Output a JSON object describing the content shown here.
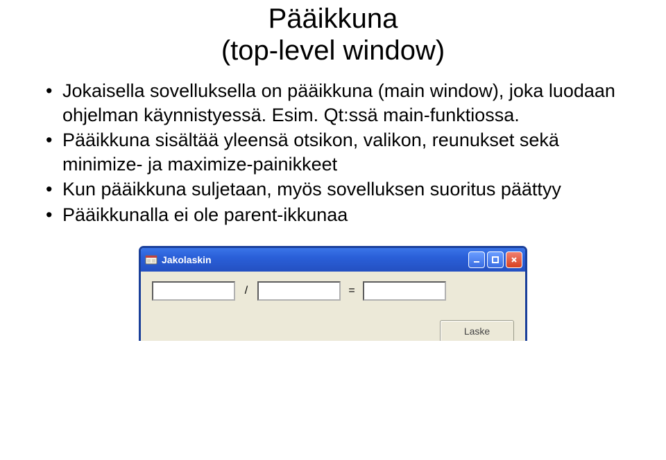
{
  "title_line1": "Pääikkuna",
  "title_line2": "(top-level window)",
  "bullets": [
    "Jokaisella sovelluksella on pääikkuna (main window), joka luodaan ohjelman käynnistyessä. Esim. Qt:ssä main-funktiossa.",
    "Pääikkuna sisältää yleensä otsikon, valikon, reunukset sekä minimize- ja maximize-painikkeet",
    "Kun pääikkuna suljetaan, myös sovelluksen suoritus päättyy",
    "Pääikkunalla ei ole parent-ikkunaa"
  ],
  "screenshot": {
    "window_title": "Jakolaskin",
    "op_divide": "/",
    "op_equals": "=",
    "button_label": "Laske"
  }
}
